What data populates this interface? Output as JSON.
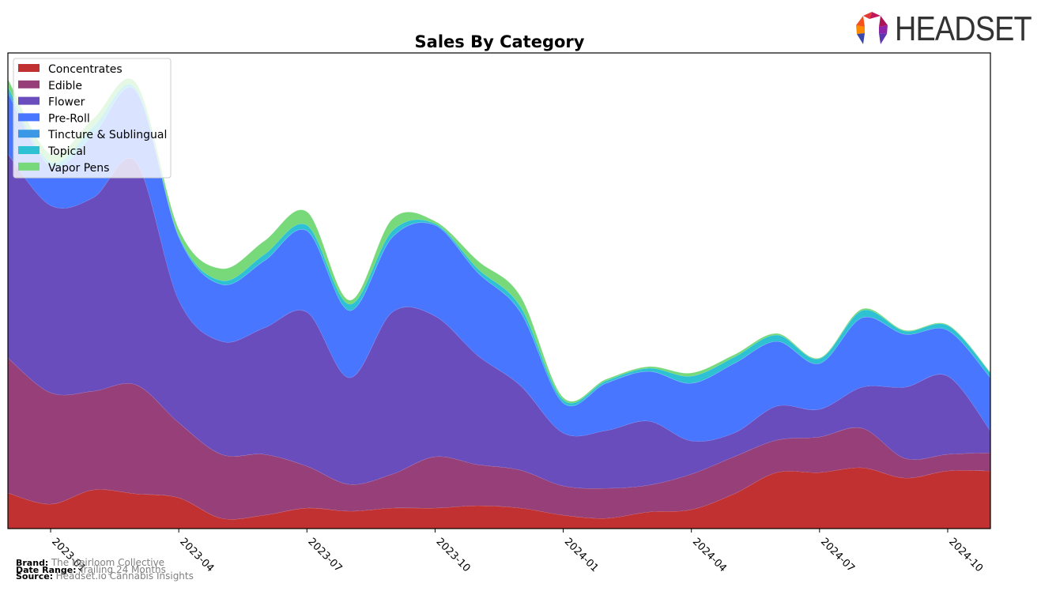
{
  "header": {
    "logo_text": "HEADSET"
  },
  "footer": {
    "brand_label": "Brand:",
    "brand_value": "The Heirloom Collective",
    "date_range_label": "Date Range:",
    "date_range_value": "Trailing 24 Months",
    "source_label": "Source:",
    "source_value": "Headset.io Cannabis Insights"
  },
  "chart_data": {
    "type": "area",
    "stacked": true,
    "smoothed": true,
    "title": "Sales By Category",
    "xlabel": "",
    "ylabel": "",
    "y_axis_visible": false,
    "grid": false,
    "legend_position": "top-left",
    "x": [
      "2022-12",
      "2023-01",
      "2023-02",
      "2023-03",
      "2023-04",
      "2023-05",
      "2023-06",
      "2023-07",
      "2023-08",
      "2023-09",
      "2023-10",
      "2023-11",
      "2023-12",
      "2024-01",
      "2024-02",
      "2024-03",
      "2024-04",
      "2024-05",
      "2024-06",
      "2024-07",
      "2024-08",
      "2024-09",
      "2024-10",
      "2024-11"
    ],
    "x_tick_labels": [
      "2023-01",
      "2023-04",
      "2023-07",
      "2023-10",
      "2024-01",
      "2024-04",
      "2024-07",
      "2024-10"
    ],
    "units": "relative (no y-axis scale shown)",
    "series": [
      {
        "name": "Concentrates",
        "color": "#c13131",
        "values": [
          45,
          31,
          49,
          44,
          39,
          13,
          17,
          26,
          22,
          26,
          26,
          29,
          26,
          17,
          13,
          21,
          24,
          44,
          71,
          71,
          77,
          64,
          73,
          73
        ]
      },
      {
        "name": "Edible",
        "color": "#963f79",
        "values": [
          171,
          141,
          125,
          138,
          95,
          81,
          77,
          53,
          34,
          43,
          65,
          52,
          48,
          37,
          38,
          34,
          45,
          47,
          41,
          45,
          50,
          25,
          21,
          23
        ]
      },
      {
        "name": "Flower",
        "color": "#6a4dbd",
        "values": [
          258,
          237,
          245,
          282,
          155,
          143,
          160,
          195,
          135,
          205,
          178,
          138,
          107,
          67,
          73,
          81,
          42,
          30,
          43,
          35,
          52,
          90,
          99,
          28
        ]
      },
      {
        "name": "Pre-Roll",
        "color": "#4876ff",
        "values": [
          77,
          50,
          80,
          90,
          80,
          72,
          85,
          103,
          85,
          95,
          115,
          105,
          93,
          38,
          60,
          63,
          73,
          88,
          82,
          58,
          88,
          67,
          58,
          67
        ]
      },
      {
        "name": "Tincture & Sublingual",
        "color": "#3a98e6",
        "values": [
          3,
          0,
          0,
          0,
          0,
          0,
          0,
          0,
          0,
          0,
          0,
          0,
          0,
          0,
          0,
          0,
          0,
          0,
          0,
          0,
          0,
          0,
          0,
          0
        ]
      },
      {
        "name": "Topical",
        "color": "#2ec1d3",
        "values": [
          5,
          5,
          10,
          3,
          2,
          5,
          8,
          7,
          8,
          8,
          2,
          5,
          7,
          4,
          3,
          4,
          9,
          8,
          8,
          6,
          9,
          4,
          6,
          6
        ]
      },
      {
        "name": "Vapor Pens",
        "color": "#77d979",
        "values": [
          10,
          10,
          10,
          7,
          8,
          15,
          17,
          17,
          5,
          15,
          3,
          10,
          13,
          3,
          2,
          2,
          4,
          3,
          2,
          1,
          2,
          1,
          1,
          1
        ]
      }
    ]
  }
}
